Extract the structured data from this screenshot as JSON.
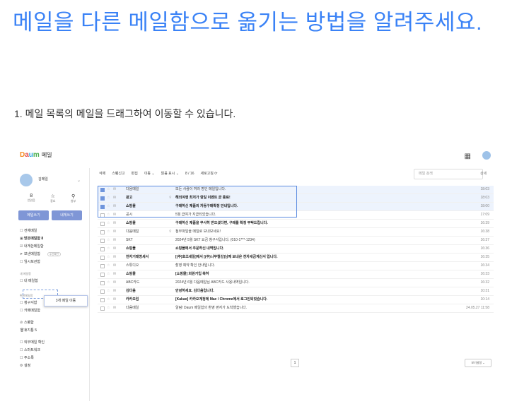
{
  "article": {
    "title": "메일을 다른 메일함으로 옮기는 방법을 알려주세요.",
    "step1": "1. 메일 목록의 메일을 드래그하여 이동할 수 있습니다."
  },
  "shot": {
    "logo": {
      "d": "D",
      "a": "a",
      "u": "u",
      "m": "m",
      "service": "메일"
    },
    "user": {
      "name": "김메일"
    },
    "stats": [
      {
        "value": "8",
        "label": "안읽음"
      },
      {
        "value": "☆",
        "label": "중요"
      },
      {
        "value": "⚲",
        "label": "첨부"
      }
    ],
    "buttons": {
      "write": "메일쓰기",
      "self": "내게쓰기"
    },
    "nav": [
      {
        "icon": "☐",
        "label": "전체메일",
        "sel": false
      },
      {
        "icon": "▣",
        "label": "받은메일함 8",
        "sel": true
      },
      {
        "icon": "☑",
        "label": "내게쓴메일함",
        "sel": false
      },
      {
        "icon": "➤",
        "label": "보낸메일함",
        "sel": false,
        "badge": "수신확인"
      },
      {
        "icon": "☐",
        "label": "임시보관함",
        "sel": false
      }
    ],
    "section_my": "내 메일함",
    "my_folder": "내 메일함",
    "section_etc": "편한메일함",
    "nav2": [
      {
        "icon": "☐",
        "label": "청구서함"
      },
      {
        "icon": "☐",
        "label": "카페메일함"
      }
    ],
    "nav3": [
      {
        "icon": "⊘",
        "label": "스팸함"
      },
      {
        "icon": "🗑",
        "label": "휴지통 5"
      }
    ],
    "nav4": [
      {
        "icon": "☐",
        "label": "외부메일 확인"
      },
      {
        "icon": "☐",
        "label": "스마트워크"
      },
      {
        "icon": "☐",
        "label": "주소록"
      },
      {
        "icon": "⚙",
        "label": "설정"
      }
    ],
    "drag_popup": "3개 메일 이동",
    "toolbar": [
      "삭제",
      "스팸신고",
      "편집",
      "이동 ⌄",
      "읽음 표시 ⌄",
      "8 / 16",
      "새로고침 ⟳"
    ],
    "search_placeholder": "메일 검색",
    "search_label": "상세",
    "mails": [
      {
        "sender": "다음메일",
        "subject": "모든 사람이 여러 명인 메일입니다.",
        "date": "18:03",
        "bold": false,
        "sel": true,
        "clip": false
      },
      {
        "sender": "광고",
        "subject": "해외여행 최저가 항일 이벤트 곧 종료!",
        "date": "18:03",
        "bold": true,
        "sel": true,
        "clip": true
      },
      {
        "sender": "쇼핑몰",
        "subject": "구매하신 제품의 자동구매확정 안내입니다.",
        "date": "18:00",
        "bold": true,
        "sel": true,
        "clip": false
      },
      {
        "sender": "공시",
        "subject": "5월 급여가 지급되었습니다.",
        "date": "17:09",
        "bold": false,
        "sel": false,
        "clip": false
      },
      {
        "sender": "쇼핑몰",
        "subject": "구매하신 제품을 무사히 받으셨다면, 구매를 확정 부탁드립니다.",
        "date": "16:39",
        "bold": true,
        "sel": false,
        "clip": false
      },
      {
        "sender": "다음메일",
        "subject": "첨부파일을 메일로 보내보세요!",
        "date": "16:38",
        "bold": false,
        "sel": false,
        "clip": true
      },
      {
        "sender": "SKT",
        "subject": "2024년 5월 SKT 요금 청구서입니다. (010-1***-1234)",
        "date": "16:37",
        "bold": false,
        "sel": false,
        "clip": false
      },
      {
        "sender": "쇼핑몰",
        "subject": "쇼핑몰에서 주문하신 내역입니다.",
        "date": "16:36",
        "bold": true,
        "sel": false,
        "clip": false
      },
      {
        "sender": "전자거래명세서",
        "subject": "[(주)호조세일]에서 [(주)나무철강]님께 보내온 전자세금계산서 입니다.",
        "date": "16:35",
        "bold": true,
        "sel": false,
        "clip": false
      },
      {
        "sender": "스튜디오",
        "subject": "촬영 예약 확인 안내입니다.",
        "date": "16:34",
        "bold": false,
        "sel": false,
        "clip": false
      },
      {
        "sender": "쇼핑몰",
        "subject": "[쇼핑몰] 회원가입 축하",
        "date": "16:33",
        "bold": true,
        "sel": false,
        "clip": false
      },
      {
        "sender": "ABC카드",
        "subject": "2024년 6월 다음메일님 ABC카드 사용내역입니다.",
        "date": "16:32",
        "bold": false,
        "sel": false,
        "clip": false
      },
      {
        "sender": "김다음",
        "subject": "안녕하세요. 김다음입니다.",
        "date": "10:31",
        "bold": true,
        "sel": false,
        "clip": false
      },
      {
        "sender": "카카오임",
        "subject": "[Kakao] 카카오계정에 Mac / Chrome에서 로그인되었습니다.",
        "date": "10:14",
        "bold": true,
        "sel": false,
        "clip": false
      },
      {
        "sender": "다음메일",
        "subject": "알림! Daum 메일함의 환영 편지가 도착했습니다.",
        "date": "24.05.27 11:58",
        "bold": false,
        "sel": false,
        "clip": false
      }
    ],
    "pager": "1",
    "page_size": "보기설정 ⌄"
  }
}
